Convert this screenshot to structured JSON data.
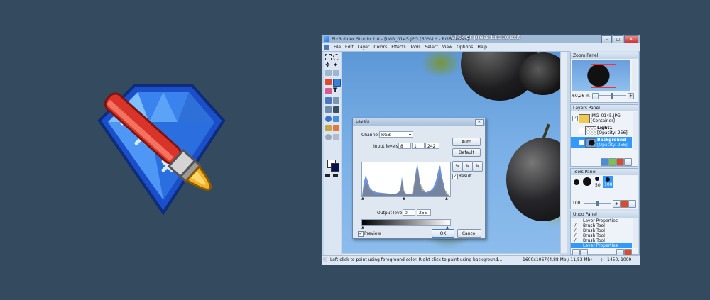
{
  "app": {
    "title": "PixBuilder Studio 2.0 - [IMG_0145.JPG (60%) * - RGB colors]",
    "fullscreen_hint": "Click or press Esc to exit"
  },
  "menu": [
    "File",
    "Edit",
    "Layer",
    "Colors",
    "Effects",
    "Tools",
    "Select",
    "View",
    "Options",
    "Help"
  ],
  "levels_dialog": {
    "title": "Levels",
    "channel_label": "Channel:",
    "channel_value": "RGB",
    "input_levels_label": "Input levels:",
    "input_values": [
      "8",
      "1",
      "242"
    ],
    "output_levels_label": "Output levels:",
    "output_values": [
      "0",
      "255"
    ],
    "auto_label": "Auto",
    "default_label": "Default",
    "result_label": "Result",
    "preview_label": "Preview",
    "ok_label": "OK",
    "cancel_label": "Cancel"
  },
  "zoom_panel": {
    "title": "Zoom Panel",
    "zoom_value": "60,26 %"
  },
  "layers_panel": {
    "title": "Layers Panel",
    "layers": [
      {
        "name": "IMG_0145.JPG",
        "info": "[Container]"
      },
      {
        "name": "Light1",
        "info": "[Opacity: 256]"
      },
      {
        "name": "Background",
        "info": "[Opacity: 256]"
      }
    ]
  },
  "tools_panel": {
    "title": "Tools Panel",
    "brush_sizes": [
      "50",
      "100"
    ],
    "size_value": "100"
  },
  "undo_panel": {
    "title": "Undo Panel",
    "items": [
      "Layer Properties",
      "Brush Tool",
      "Brush Tool",
      "Brush Tool",
      "Brush Tool",
      "Layer Properties"
    ]
  },
  "status": {
    "hint": "Left click to paint using foreground color. Right click to paint using background...",
    "image_size": "1600x1067",
    "memory": "(4,88 Mb / 11,53 Mb)",
    "cursor": "1450, 1009"
  },
  "colors": {
    "background": "#344a5e",
    "selection": "#3399ff",
    "foreground_color": "#ffffff",
    "background_color": "#0a1050"
  }
}
